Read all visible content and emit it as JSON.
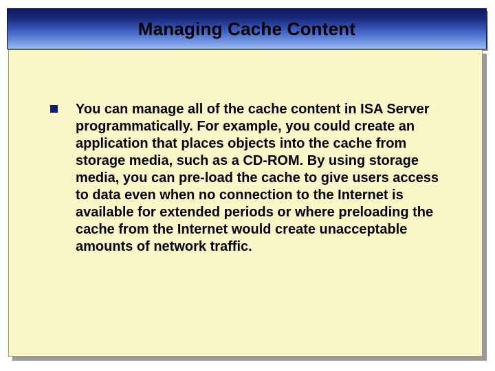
{
  "title": "Managing Cache Content",
  "bullets": [
    {
      "text": "You can manage all of the cache content in ISA Server programmatically. For example, you could create an application that places objects into the cache from storage media, such as a CD-ROM. By using storage media, you can pre-load the cache to give users access to data even when no connection to the Internet is available for extended periods or where preloading the cache from the Internet would create unacceptable amounts of network traffic."
    }
  ]
}
